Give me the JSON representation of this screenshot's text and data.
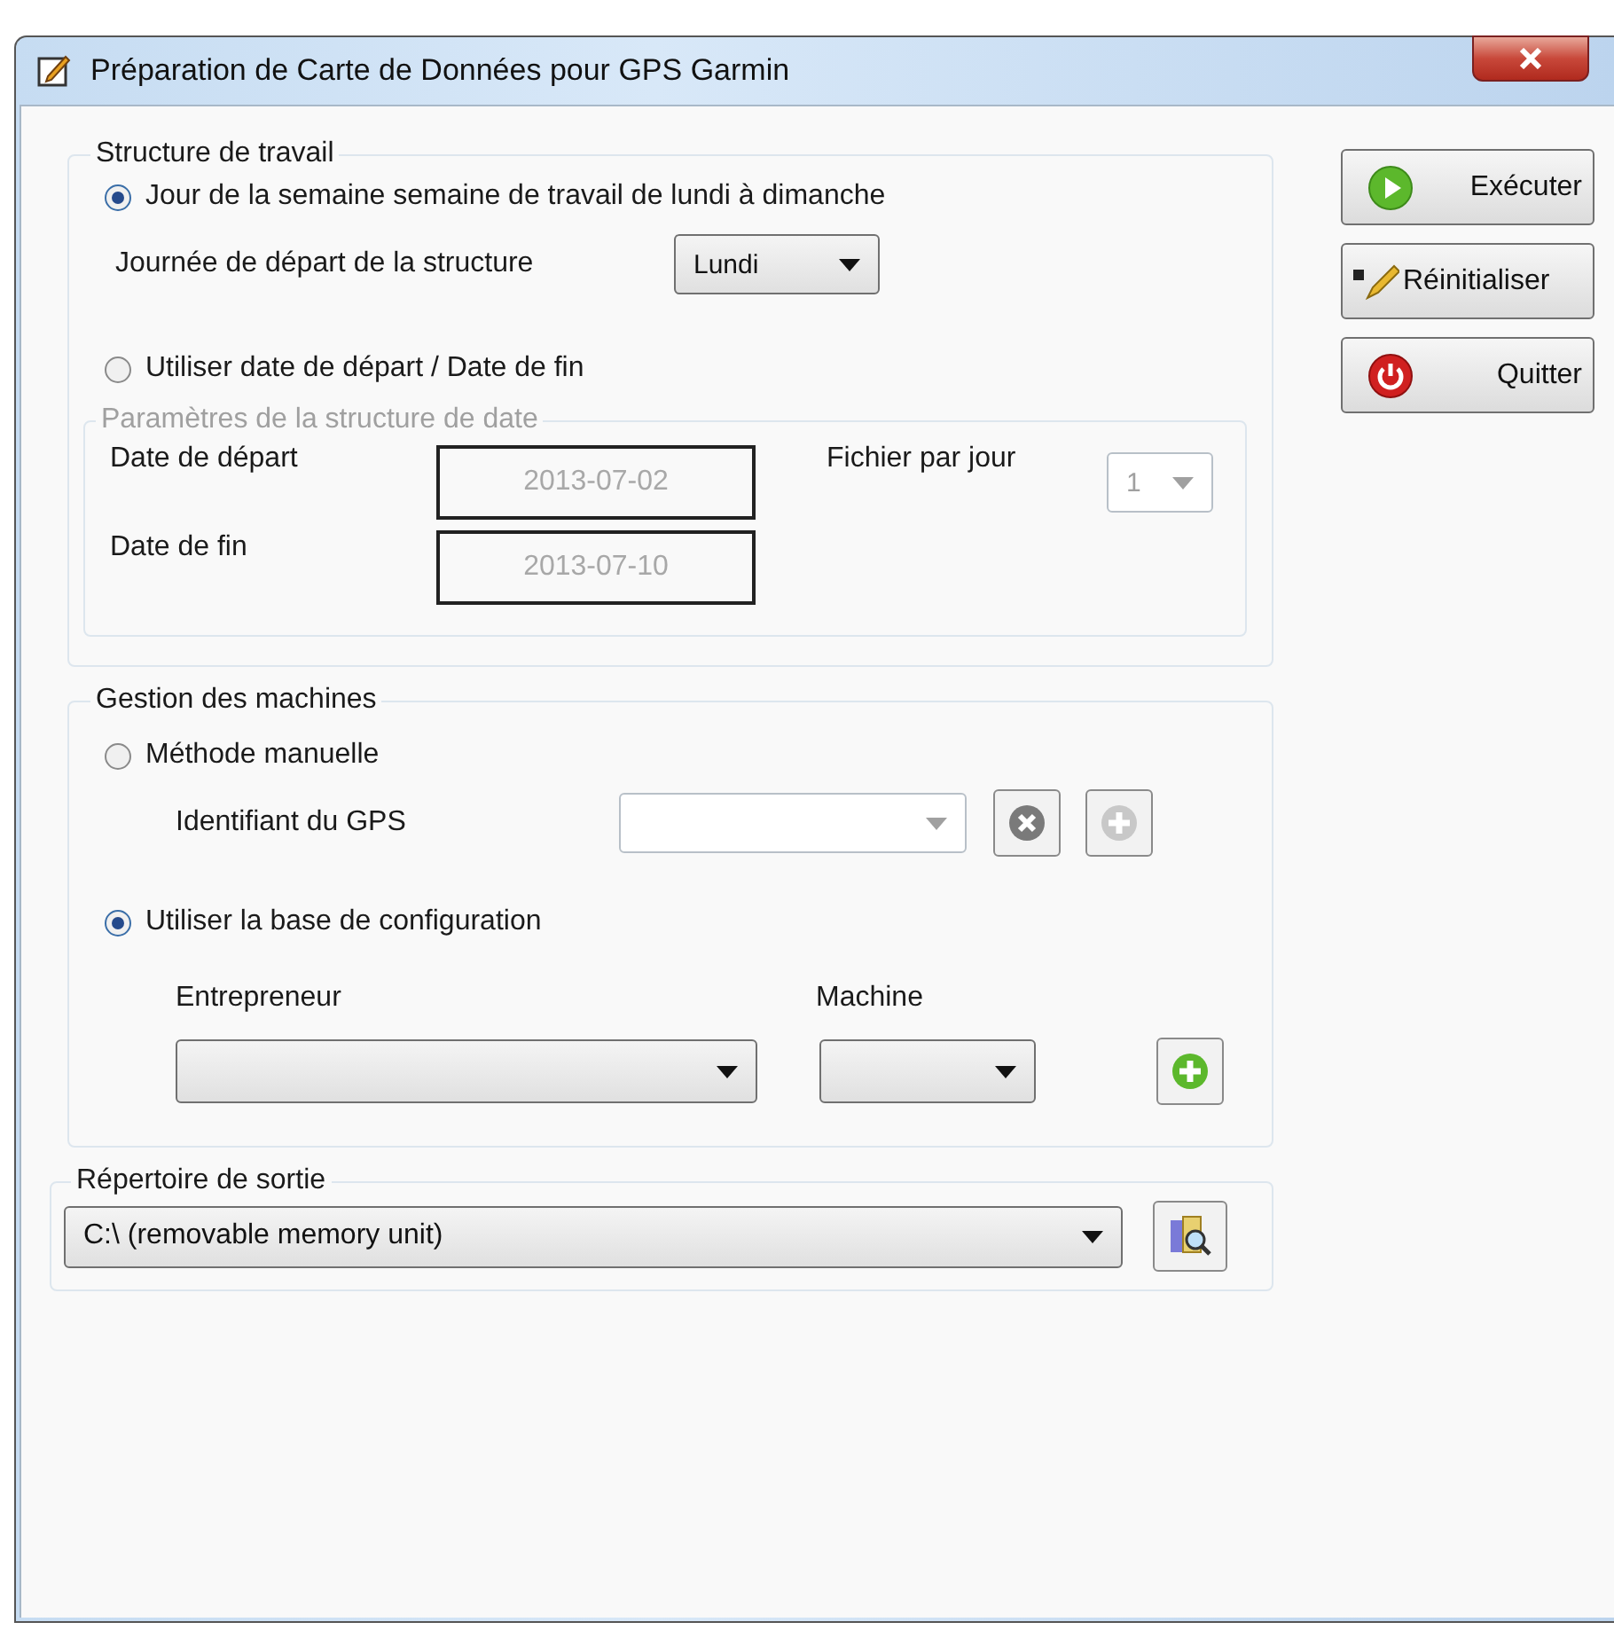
{
  "window": {
    "title": "Préparation de Carte de Données pour GPS Garmin"
  },
  "work_structure": {
    "title": "Structure de travail",
    "options": [
      {
        "label": "Jour de la semaine semaine de travail de lundi à dimanche",
        "selected": true
      },
      {
        "label": "Utiliser date de départ / Date de fin",
        "selected": false
      }
    ],
    "start_day": {
      "label": "Journée de départ de la structure",
      "value": "Lundi"
    },
    "date_params": {
      "title": "Paramètres de la structure de date",
      "disabled": true,
      "start": {
        "label": "Date de départ",
        "value": "2013-07-02"
      },
      "end": {
        "label": "Date de fin",
        "value": "2013-07-10"
      },
      "files_per_day": {
        "label": "Fichier par jour",
        "value": "1"
      }
    }
  },
  "machines": {
    "title": "Gestion des machines",
    "options": [
      {
        "label": "Méthode manuelle",
        "selected": false
      },
      {
        "label": "Utiliser la base de configuration",
        "selected": true
      }
    ],
    "gps_id": {
      "label": "Identifiant du GPS"
    },
    "gps_buttons": [
      {
        "kind": "remove",
        "disabled": false
      },
      {
        "kind": "add",
        "disabled": true
      }
    ],
    "entrepreneur": {
      "label": "Entrepreneur"
    },
    "machine": {
      "label": "Machine"
    }
  },
  "output": {
    "title": "Répertoire de sortie",
    "path": "C:\\ (removable memory unit)"
  },
  "actions": [
    {
      "kind": "run",
      "label": "Exécuter"
    },
    {
      "kind": "reset",
      "label": "Réinitialiser"
    },
    {
      "kind": "quit",
      "label": "Quitter"
    }
  ]
}
